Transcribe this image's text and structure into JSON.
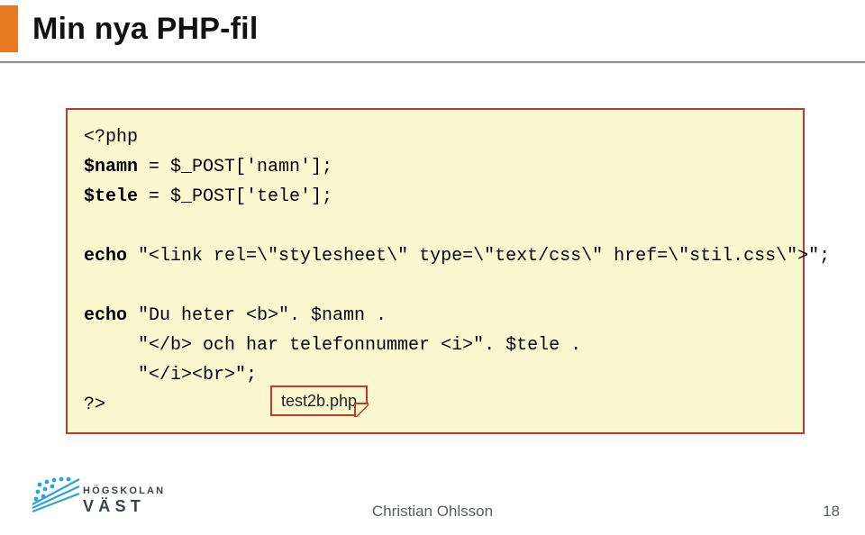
{
  "title": "Min nya PHP-fil",
  "code": {
    "l1a": "<?php",
    "l2a": "$namn",
    "l2b": " = $_POST['namn'];",
    "l3a": "$tele",
    "l3b": " = $_POST['tele'];",
    "blank1": "",
    "l4a": "echo",
    "l4b": " \"<link rel=\\\"stylesheet\\\" type=\\\"text/css\\\" href=\\\"stil.css\\\">\";",
    "blank2": "",
    "l5a": "echo",
    "l5b": " \"Du heter <b>\". $namn .",
    "l6": "     \"</b> och har telefonnummer <i>\". $tele .",
    "l7": "     \"</i><br>\";",
    "l8": "?>"
  },
  "fileLabel": "test2b.php",
  "footer": {
    "author": "Christian Ohlsson",
    "page": "18"
  },
  "logo": {
    "line1": "HÖGSKOLAN",
    "line2": "VÄST"
  }
}
